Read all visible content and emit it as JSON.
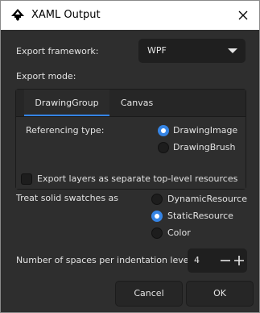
{
  "window": {
    "title": "XAML Output",
    "app_icon": "inkscape-icon",
    "close_icon": "close-icon"
  },
  "export_framework": {
    "label": "Export framework:",
    "selected": "WPF"
  },
  "export_mode": {
    "label": "Export mode:",
    "tabs": [
      {
        "label": "DrawingGroup",
        "active": true
      },
      {
        "label": "Canvas",
        "active": false
      }
    ],
    "referencing": {
      "label": "Referencing type:",
      "options": [
        {
          "label": "DrawingImage",
          "selected": true
        },
        {
          "label": "DrawingBrush",
          "selected": false
        }
      ]
    }
  },
  "export_layers": {
    "label": "Export layers as separate top-level resources",
    "checked": false
  },
  "swatches": {
    "label": "Treat solid swatches as",
    "options": [
      {
        "label": "DynamicResource",
        "selected": false
      },
      {
        "label": "StaticResource",
        "selected": true
      },
      {
        "label": "Color",
        "selected": false
      }
    ]
  },
  "indentation": {
    "label": "Number of spaces per indentation level:",
    "value": "4",
    "minus_icon": "minus-icon",
    "plus_icon": "plus-icon"
  },
  "buttons": {
    "cancel": "Cancel",
    "ok": "OK"
  },
  "colors": {
    "accent": "#3584e4",
    "background": "#2e2e2e",
    "titlebar": "#ffffff"
  }
}
